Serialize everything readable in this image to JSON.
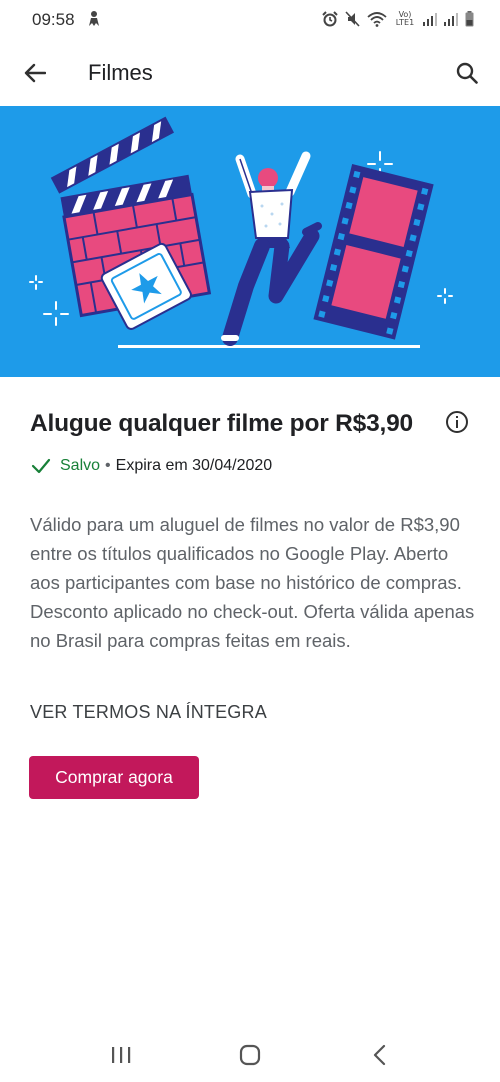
{
  "status_bar": {
    "time": "09:58",
    "network_label": "Vo) LTE1"
  },
  "app_bar": {
    "title": "Filmes",
    "back_icon": "arrow-back-icon",
    "search_icon": "search-icon"
  },
  "offer": {
    "title": "Alugue qualquer filme por R$3,90",
    "saved_label": "Salvo",
    "separator": "•",
    "expires": "Expira em 30/04/2020",
    "description": "Válido para um aluguel de filmes no valor de R$3,90 entre os títulos qualificados no Google Play. Aberto aos participantes com base no histórico de compras. Desconto aplicado no check-out. Oferta válida apenas no Brasil para compras feitas em reais.",
    "terms_link": "VER TERMOS NA ÍNTEGRA",
    "buy_button": "Comprar agora"
  },
  "colors": {
    "banner": "#1e9be9",
    "accent": "#c2185b",
    "saved": "#188038"
  }
}
